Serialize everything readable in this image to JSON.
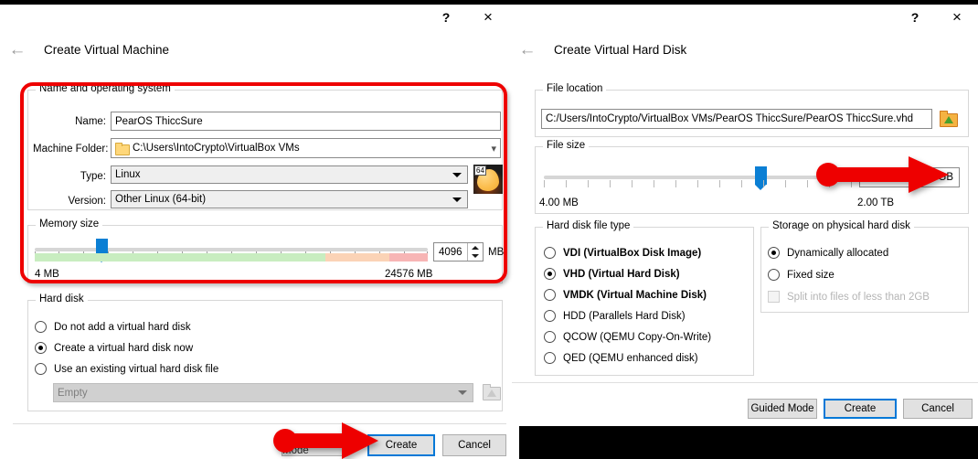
{
  "left_dialog": {
    "title": "Create Virtual Machine",
    "titlebar": {
      "help": "?",
      "close": "×"
    },
    "back_icon": "←",
    "groups": {
      "name_os": {
        "legend": "Name and operating system",
        "fields": [
          {
            "label": "Name:",
            "value": "PearOS ThiccSure",
            "kind": "text"
          },
          {
            "label": "Machine Folder:",
            "value": "C:\\Users\\IntoCrypto\\VirtualBox VMs",
            "kind": "folder-combo"
          },
          {
            "label": "Type:",
            "value": "Linux",
            "kind": "combo"
          },
          {
            "label": "Version:",
            "value": "Other Linux (64-bit)",
            "kind": "combo"
          }
        ],
        "os_icon_badge": "64"
      },
      "memory": {
        "legend": "Memory size",
        "min_label": "4 MB",
        "max_label": "24576 MB",
        "value": "4096",
        "unit": "MB",
        "slider_percent": 17,
        "green_end_percent": 74,
        "orange_end_percent": 90,
        "colors": {
          "green": "#c8edc0",
          "orange": "#fbd3b6",
          "red": "#f7b5b5",
          "handle": "#0b7fd4"
        }
      },
      "hard_disk": {
        "legend": "Hard disk",
        "options": [
          {
            "label": "Do not add a virtual hard disk",
            "selected": false
          },
          {
            "label": "Create a virtual hard disk now",
            "selected": true
          },
          {
            "label": "Use an existing virtual hard disk file",
            "selected": false
          }
        ],
        "existing_disk_value": "Empty"
      }
    },
    "buttons": {
      "guided": "Guided Mode",
      "create": "Create",
      "cancel": "Cancel"
    }
  },
  "right_dialog": {
    "title": "Create Virtual Hard Disk",
    "titlebar": {
      "help": "?",
      "close": "×"
    },
    "back_icon": "←",
    "groups": {
      "file_location": {
        "legend": "File location",
        "value": "C:/Users/IntoCrypto/VirtualBox VMs/PearOS ThiccSure/PearOS ThiccSure.vhd"
      },
      "file_size": {
        "legend": "File size",
        "min_label": "4.00 MB",
        "max_label": "2.00 TB",
        "value": "30.79 GB",
        "slider_percent": 52
      },
      "disk_file_type": {
        "legend": "Hard disk file type",
        "options": [
          {
            "label": "VDI (VirtualBox Disk Image)",
            "selected": false,
            "bold": true
          },
          {
            "label": "VHD (Virtual Hard Disk)",
            "selected": true,
            "bold": true
          },
          {
            "label": "VMDK (Virtual Machine Disk)",
            "selected": false,
            "bold": true
          },
          {
            "label": "HDD (Parallels Hard Disk)",
            "selected": false,
            "bold": false
          },
          {
            "label": "QCOW (QEMU Copy-On-Write)",
            "selected": false,
            "bold": false
          },
          {
            "label": "QED (QEMU enhanced disk)",
            "selected": false,
            "bold": false
          }
        ]
      },
      "storage": {
        "legend": "Storage on physical hard disk",
        "options": [
          {
            "label": "Dynamically allocated",
            "selected": true
          },
          {
            "label": "Fixed size",
            "selected": false
          }
        ],
        "checkbox": {
          "label": "Split into files of less than 2GB",
          "checked": false,
          "disabled": true
        }
      }
    },
    "buttons": {
      "guided": "Guided Mode",
      "create": "Create",
      "cancel": "Cancel"
    }
  },
  "annotations": {
    "color": "#ee0000",
    "highlight_box": "name-os-and-memory-highlight",
    "arrow_left_target": "Create",
    "arrow_right_target": "30.79 GB"
  }
}
